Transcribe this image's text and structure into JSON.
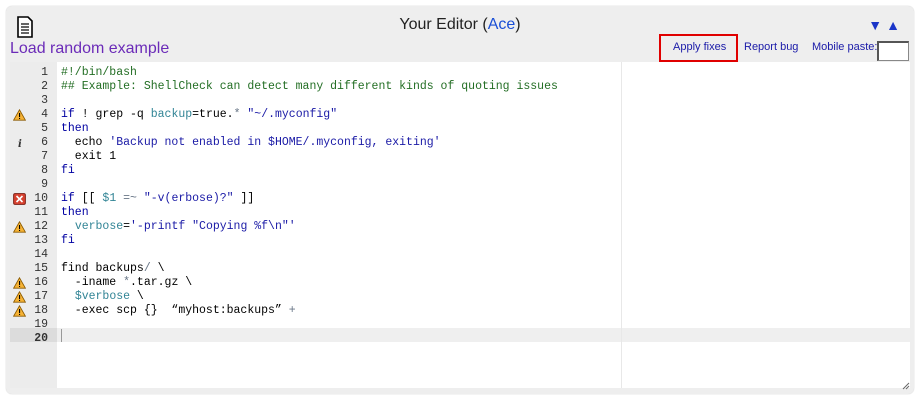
{
  "header": {
    "title_prefix": "Your Editor (",
    "title_link": "Ace",
    "title_suffix": ")",
    "down_arrow": "▼",
    "up_arrow": "▲"
  },
  "toolbar": {
    "random_example": "Load random example",
    "apply_fixes": "Apply fixes",
    "report_bug": "Report bug",
    "mobile_paste": "Mobile paste:"
  },
  "editor": {
    "active_line": 20,
    "lines": [
      {
        "n": "1",
        "marker": "",
        "tokens": [
          {
            "t": "#!/bin/bash",
            "c": "c-comment"
          }
        ]
      },
      {
        "n": "2",
        "marker": "",
        "tokens": [
          {
            "t": "## Example: ShellCheck can detect many different kinds of quoting issues",
            "c": "c-comment"
          }
        ]
      },
      {
        "n": "3",
        "marker": "",
        "tokens": []
      },
      {
        "n": "4",
        "marker": "warning",
        "tokens": [
          {
            "t": "if",
            "c": "c-kw"
          },
          {
            "t": " ! grep -q ",
            "c": ""
          },
          {
            "t": "backup",
            "c": "c-var"
          },
          {
            "t": "=true.",
            "c": ""
          },
          {
            "t": "*",
            "c": "c-op"
          },
          {
            "t": " \"~/.myconfig\"",
            "c": "c-str"
          }
        ]
      },
      {
        "n": "5",
        "marker": "",
        "tokens": [
          {
            "t": "then",
            "c": "c-kw"
          }
        ]
      },
      {
        "n": "6",
        "marker": "info",
        "tokens": [
          {
            "t": "  echo ",
            "c": ""
          },
          {
            "t": "'Backup not enabled in $HOME/.myconfig, exiting'",
            "c": "c-str"
          }
        ]
      },
      {
        "n": "7",
        "marker": "",
        "tokens": [
          {
            "t": "  exit 1",
            "c": ""
          }
        ]
      },
      {
        "n": "8",
        "marker": "",
        "tokens": [
          {
            "t": "fi",
            "c": "c-kw"
          }
        ]
      },
      {
        "n": "9",
        "marker": "",
        "tokens": []
      },
      {
        "n": "10",
        "marker": "error",
        "tokens": [
          {
            "t": "if",
            "c": "c-kw"
          },
          {
            "t": " [[ ",
            "c": ""
          },
          {
            "t": "$1",
            "c": "c-var"
          },
          {
            "t": " =~ ",
            "c": "c-op"
          },
          {
            "t": "\"-v(erbose)?\"",
            "c": "c-str"
          },
          {
            "t": " ]]",
            "c": ""
          }
        ]
      },
      {
        "n": "11",
        "marker": "",
        "tokens": [
          {
            "t": "then",
            "c": "c-kw"
          }
        ]
      },
      {
        "n": "12",
        "marker": "warning",
        "tokens": [
          {
            "t": "  ",
            "c": ""
          },
          {
            "t": "verbose",
            "c": "c-var"
          },
          {
            "t": "=",
            "c": ""
          },
          {
            "t": "'-printf \"Copying %f\\n\"'",
            "c": "c-str"
          }
        ]
      },
      {
        "n": "13",
        "marker": "",
        "tokens": [
          {
            "t": "fi",
            "c": "c-kw"
          }
        ]
      },
      {
        "n": "14",
        "marker": "",
        "tokens": []
      },
      {
        "n": "15",
        "marker": "",
        "tokens": [
          {
            "t": "find backups",
            "c": ""
          },
          {
            "t": "/",
            "c": "c-op"
          },
          {
            "t": " \\",
            "c": ""
          }
        ]
      },
      {
        "n": "16",
        "marker": "warning",
        "tokens": [
          {
            "t": "  -iname ",
            "c": ""
          },
          {
            "t": "*",
            "c": "c-op"
          },
          {
            "t": ".tar.gz \\",
            "c": ""
          }
        ]
      },
      {
        "n": "17",
        "marker": "warning",
        "tokens": [
          {
            "t": "  ",
            "c": ""
          },
          {
            "t": "$verbose",
            "c": "c-var"
          },
          {
            "t": " \\",
            "c": ""
          }
        ]
      },
      {
        "n": "18",
        "marker": "warning",
        "tokens": [
          {
            "t": "  -exec scp {}  “myhost:backups” ",
            "c": ""
          },
          {
            "t": "+",
            "c": "c-op"
          }
        ]
      },
      {
        "n": "19",
        "marker": "",
        "tokens": []
      },
      {
        "n": "20",
        "marker": "",
        "tokens": []
      }
    ]
  }
}
